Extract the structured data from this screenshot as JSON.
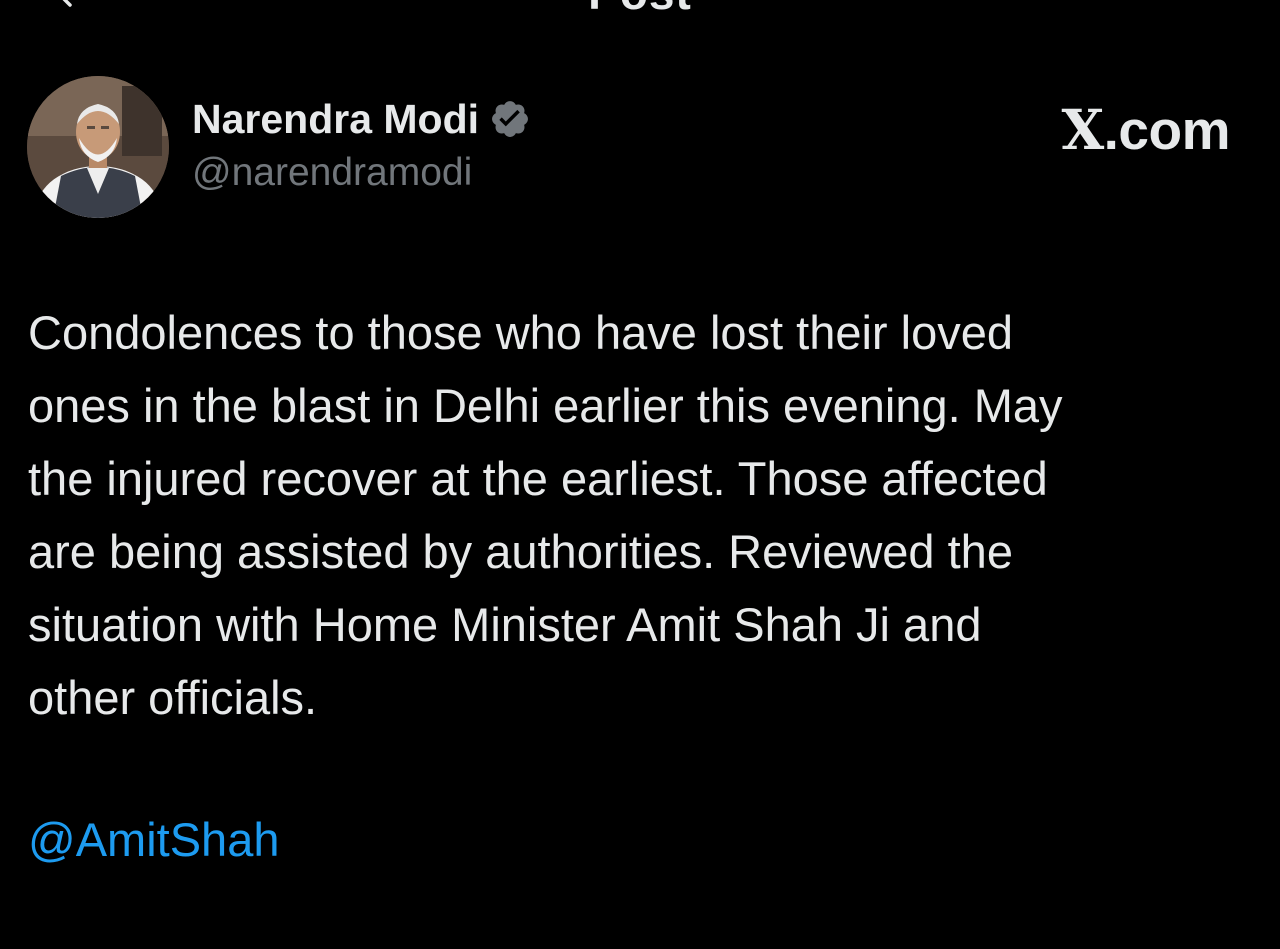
{
  "header": {
    "title": "Post",
    "back_icon": "chevron-left-icon"
  },
  "author": {
    "display_name": "Narendra Modi",
    "handle": "@narendramodi",
    "verified_icon": "verified-badge-icon",
    "verified_color": "#71767b"
  },
  "watermark": {
    "x_glyph": "X",
    "suffix": ".com"
  },
  "tweet": {
    "lines": [
      "Condolences to those who have lost their loved",
      "ones in the blast in Delhi earlier this evening. May",
      "the injured recover at the earliest. Those affected",
      "are being assisted by authorities. Reviewed the",
      "situation with Home Minister Amit Shah Ji and",
      "other officials."
    ],
    "mention": "@AmitShah"
  },
  "colors": {
    "background": "#000000",
    "text": "#e7e9ea",
    "secondary": "#71767b",
    "link": "#1d9bf0"
  }
}
